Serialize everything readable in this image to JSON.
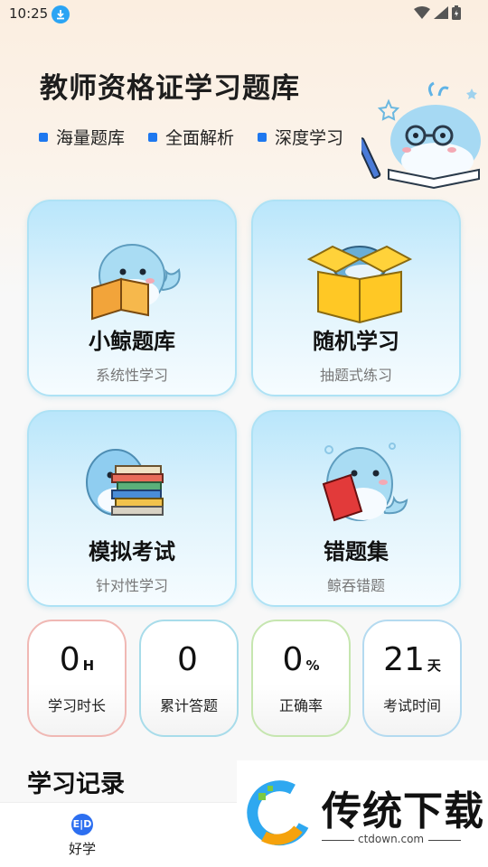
{
  "status_bar": {
    "time": "10:25"
  },
  "header": {
    "title": "教师资格证学习题库",
    "tags": [
      "海量题库",
      "全面解析",
      "深度学习"
    ]
  },
  "cards": [
    {
      "title": "小鲸题库",
      "subtitle": "系统性学习",
      "icon": "whale-reading-book-icon"
    },
    {
      "title": "随机学习",
      "subtitle": "抽题式练习",
      "icon": "whale-in-box-icon"
    },
    {
      "title": "模拟考试",
      "subtitle": "针对性学习",
      "icon": "whale-with-book-stack-icon"
    },
    {
      "title": "错题集",
      "subtitle": "鲸吞错题",
      "icon": "whale-eating-book-icon"
    }
  ],
  "stats": [
    {
      "value": "0",
      "unit": "H",
      "label": "学习时长",
      "accent": "#f0b8b4"
    },
    {
      "value": "0",
      "unit": "",
      "label": "累计答题",
      "accent": "#a8dcea"
    },
    {
      "value": "0",
      "unit": "%",
      "label": "正确率",
      "accent": "#c6e6b0"
    },
    {
      "value": "21",
      "unit": "天",
      "label": "考试时间",
      "accent": "#b4daf0"
    }
  ],
  "section": {
    "title": "学习记录"
  },
  "bottom_nav": {
    "home_label": "好学",
    "home_icon_text": "E|D"
  },
  "watermark": {
    "text": "传统下载",
    "url": "ctdown.com"
  },
  "colors": {
    "accent_blue": "#1e78ef",
    "card_border": "#aee2f5"
  }
}
